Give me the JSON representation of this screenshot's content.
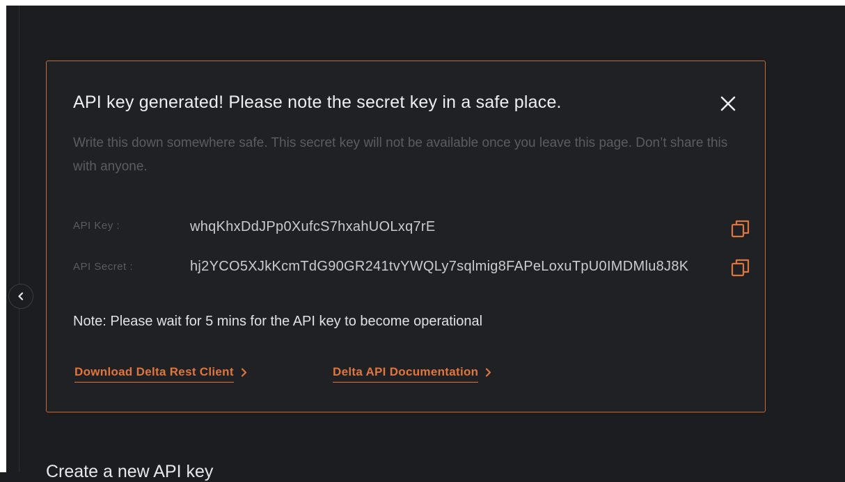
{
  "modal": {
    "title": "API key generated! Please note the secret key in a safe place.",
    "description": "Write this down somewhere safe. This secret key will not be available once you leave this page. Don’t share this with anyone.",
    "api_key_label": "API Key :",
    "api_key_value": "whqKhxDdJPp0XufcS7hxahUOLxq7rE",
    "api_secret_label": "API Secret :",
    "api_secret_value": "hj2YCO5XJkKcmTdG90GR241tvYWQLy7sqlmig8FAPeLoxuTpU0IMDMlu8J8K",
    "note": "Note: Please wait for 5 mins for the API key to become operational",
    "links": {
      "download_client": "Download Delta Rest Client",
      "api_docs": "Delta API Documentation"
    },
    "icons": {
      "close": "close-icon",
      "copy": "copy-icon",
      "chevron": "chevron-right-icon"
    }
  },
  "sidebar": {
    "toggle_icon": "chevron-left-icon"
  },
  "section": {
    "create_title": "Create a new API key"
  },
  "colors": {
    "background": "#1b1d20",
    "accent": "#e0763d",
    "modal_border": "#c66a36",
    "muted_text": "#595d62"
  }
}
